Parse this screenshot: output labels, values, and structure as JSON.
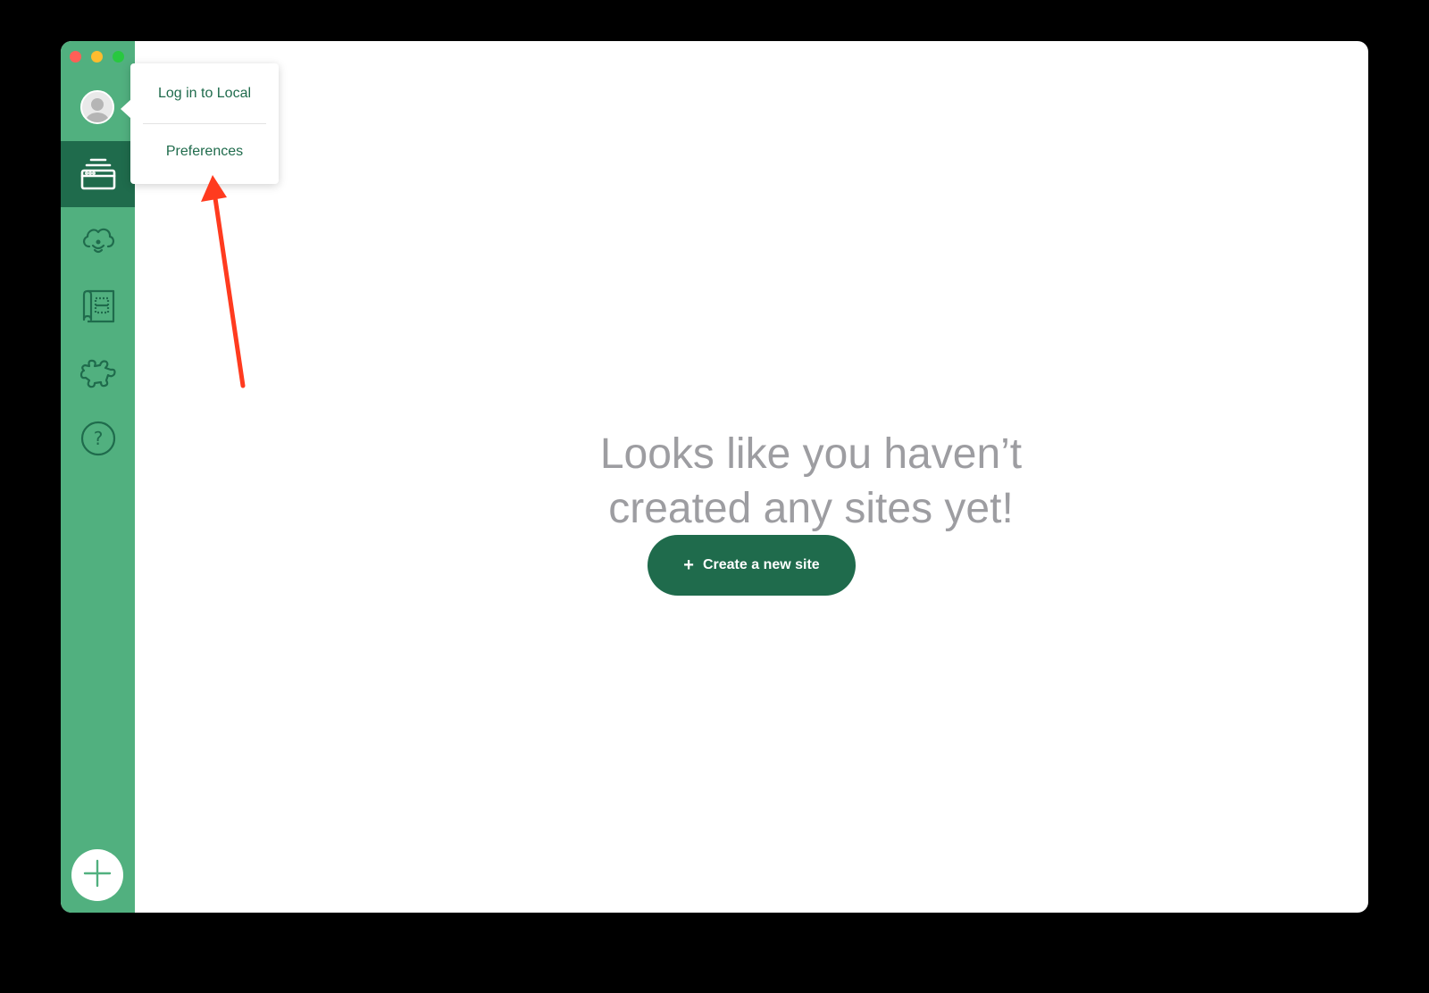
{
  "window": {
    "traffic_lights": [
      "close",
      "minimize",
      "zoom"
    ],
    "colors": {
      "sidebar": "#51b07f",
      "sidebar_active": "#1f6b4c",
      "accent": "#1f6b4c",
      "empty_text": "#9d9da1",
      "annotation_arrow": "#ff3b1f"
    }
  },
  "sidebar": {
    "avatar_icon": "user-avatar-icon",
    "items": [
      {
        "name": "local-sites",
        "icon": "sites-stack-icon",
        "active": true
      },
      {
        "name": "connect",
        "icon": "cloud-sync-icon",
        "active": false
      },
      {
        "name": "blueprints",
        "icon": "blueprint-icon",
        "active": false
      },
      {
        "name": "add-ons",
        "icon": "puzzle-icon",
        "active": false
      },
      {
        "name": "help",
        "icon": "help-circle-icon",
        "active": false
      }
    ],
    "add_icon": "plus-icon"
  },
  "popup": {
    "login_label": "Log in to Local",
    "preferences_label": "Preferences"
  },
  "main": {
    "empty_line1": "Looks like you haven’t",
    "empty_line2": "created any sites yet!",
    "create_plus": "+",
    "create_label": "Create a new site"
  }
}
